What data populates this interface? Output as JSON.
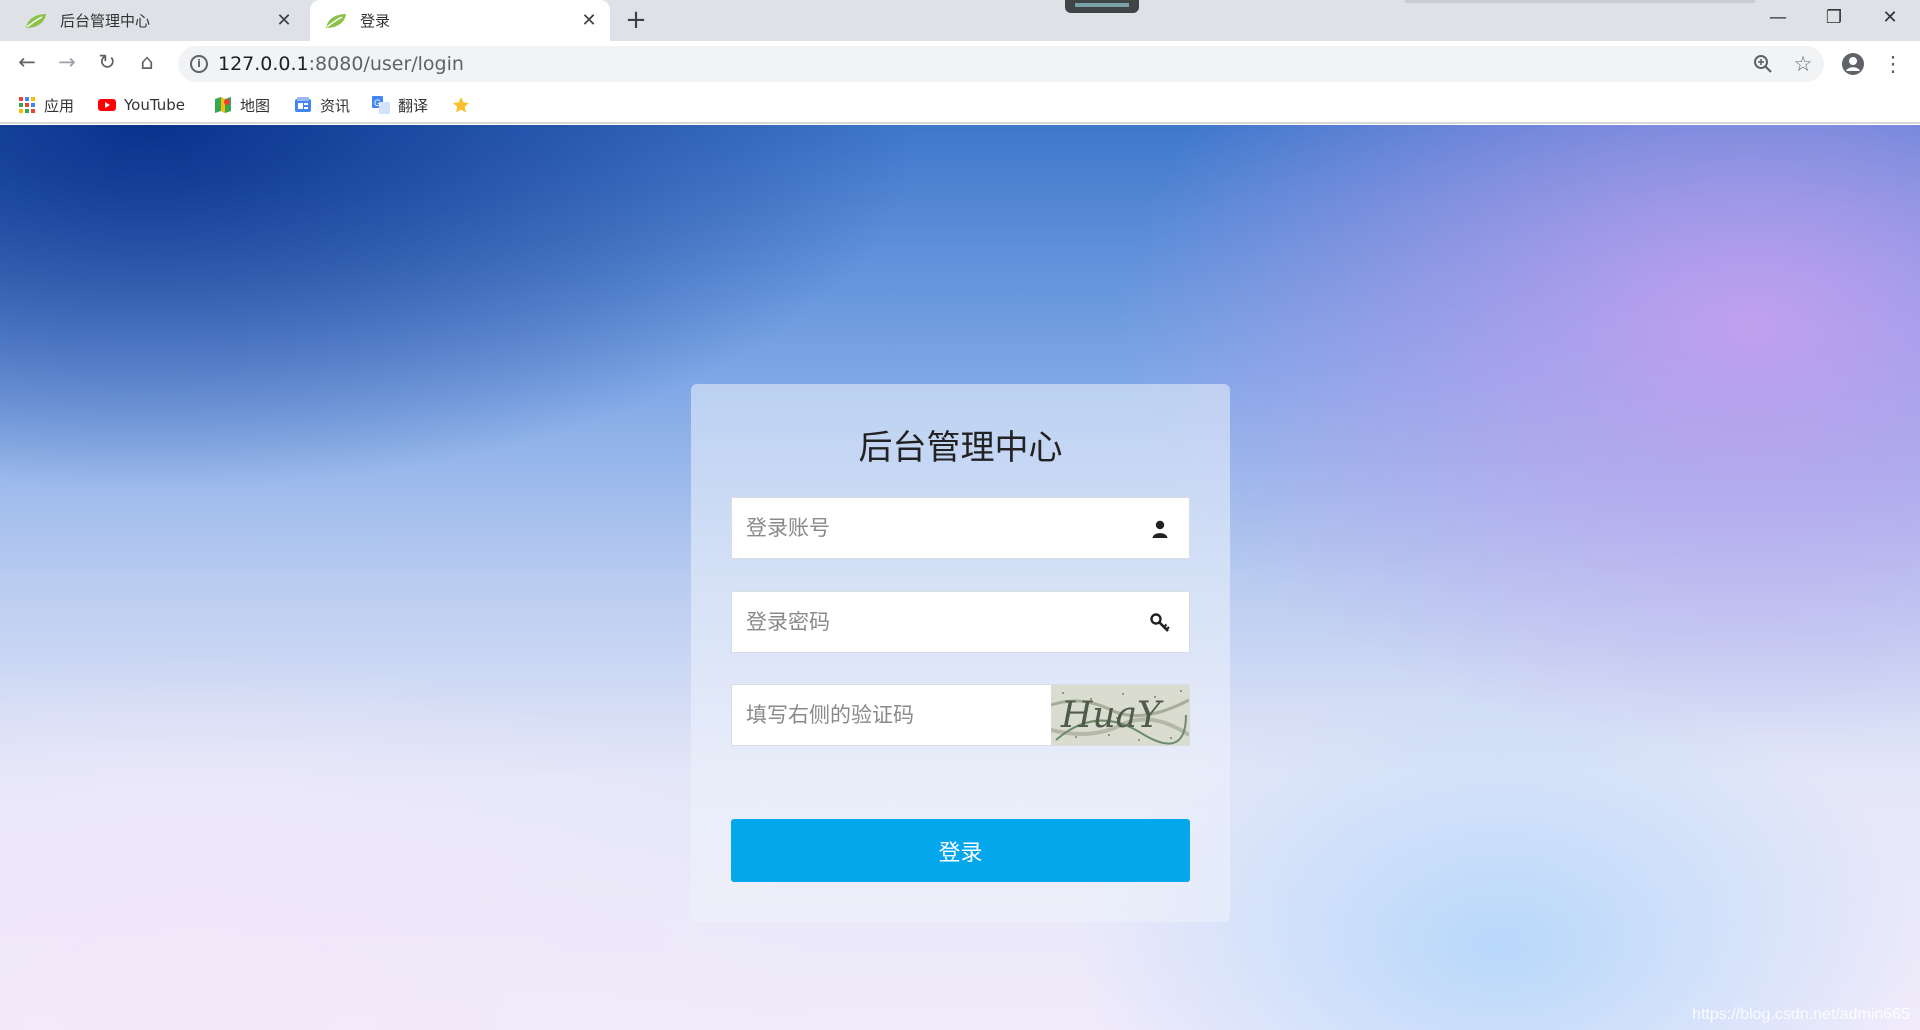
{
  "browser": {
    "tabs": [
      {
        "title": "后台管理中心",
        "active": false,
        "favicon": "spring-leaf-icon"
      },
      {
        "title": "登录",
        "active": true,
        "favicon": "spring-leaf-icon"
      }
    ],
    "address": {
      "host": "127.0.0.1",
      "rest": ":8080/user/login"
    },
    "bookmarks": [
      {
        "label": "应用",
        "icon": "apps-grid-icon"
      },
      {
        "label": "YouTube",
        "icon": "youtube-icon"
      },
      {
        "label": "地图",
        "icon": "maps-icon"
      },
      {
        "label": "资讯",
        "icon": "news-icon"
      },
      {
        "label": "翻译",
        "icon": "translate-icon"
      },
      {
        "label": "",
        "icon": "star-bookmark-icon"
      }
    ]
  },
  "login": {
    "title": "后台管理中心",
    "username_placeholder": "登录账号",
    "password_placeholder": "登录密码",
    "captcha_placeholder": "填写右侧的验证码",
    "captcha_text": "HuaY",
    "submit_label": "登录",
    "accent_color": "#04a7ec"
  },
  "watermark": "https://blog.csdn.net/admin665"
}
